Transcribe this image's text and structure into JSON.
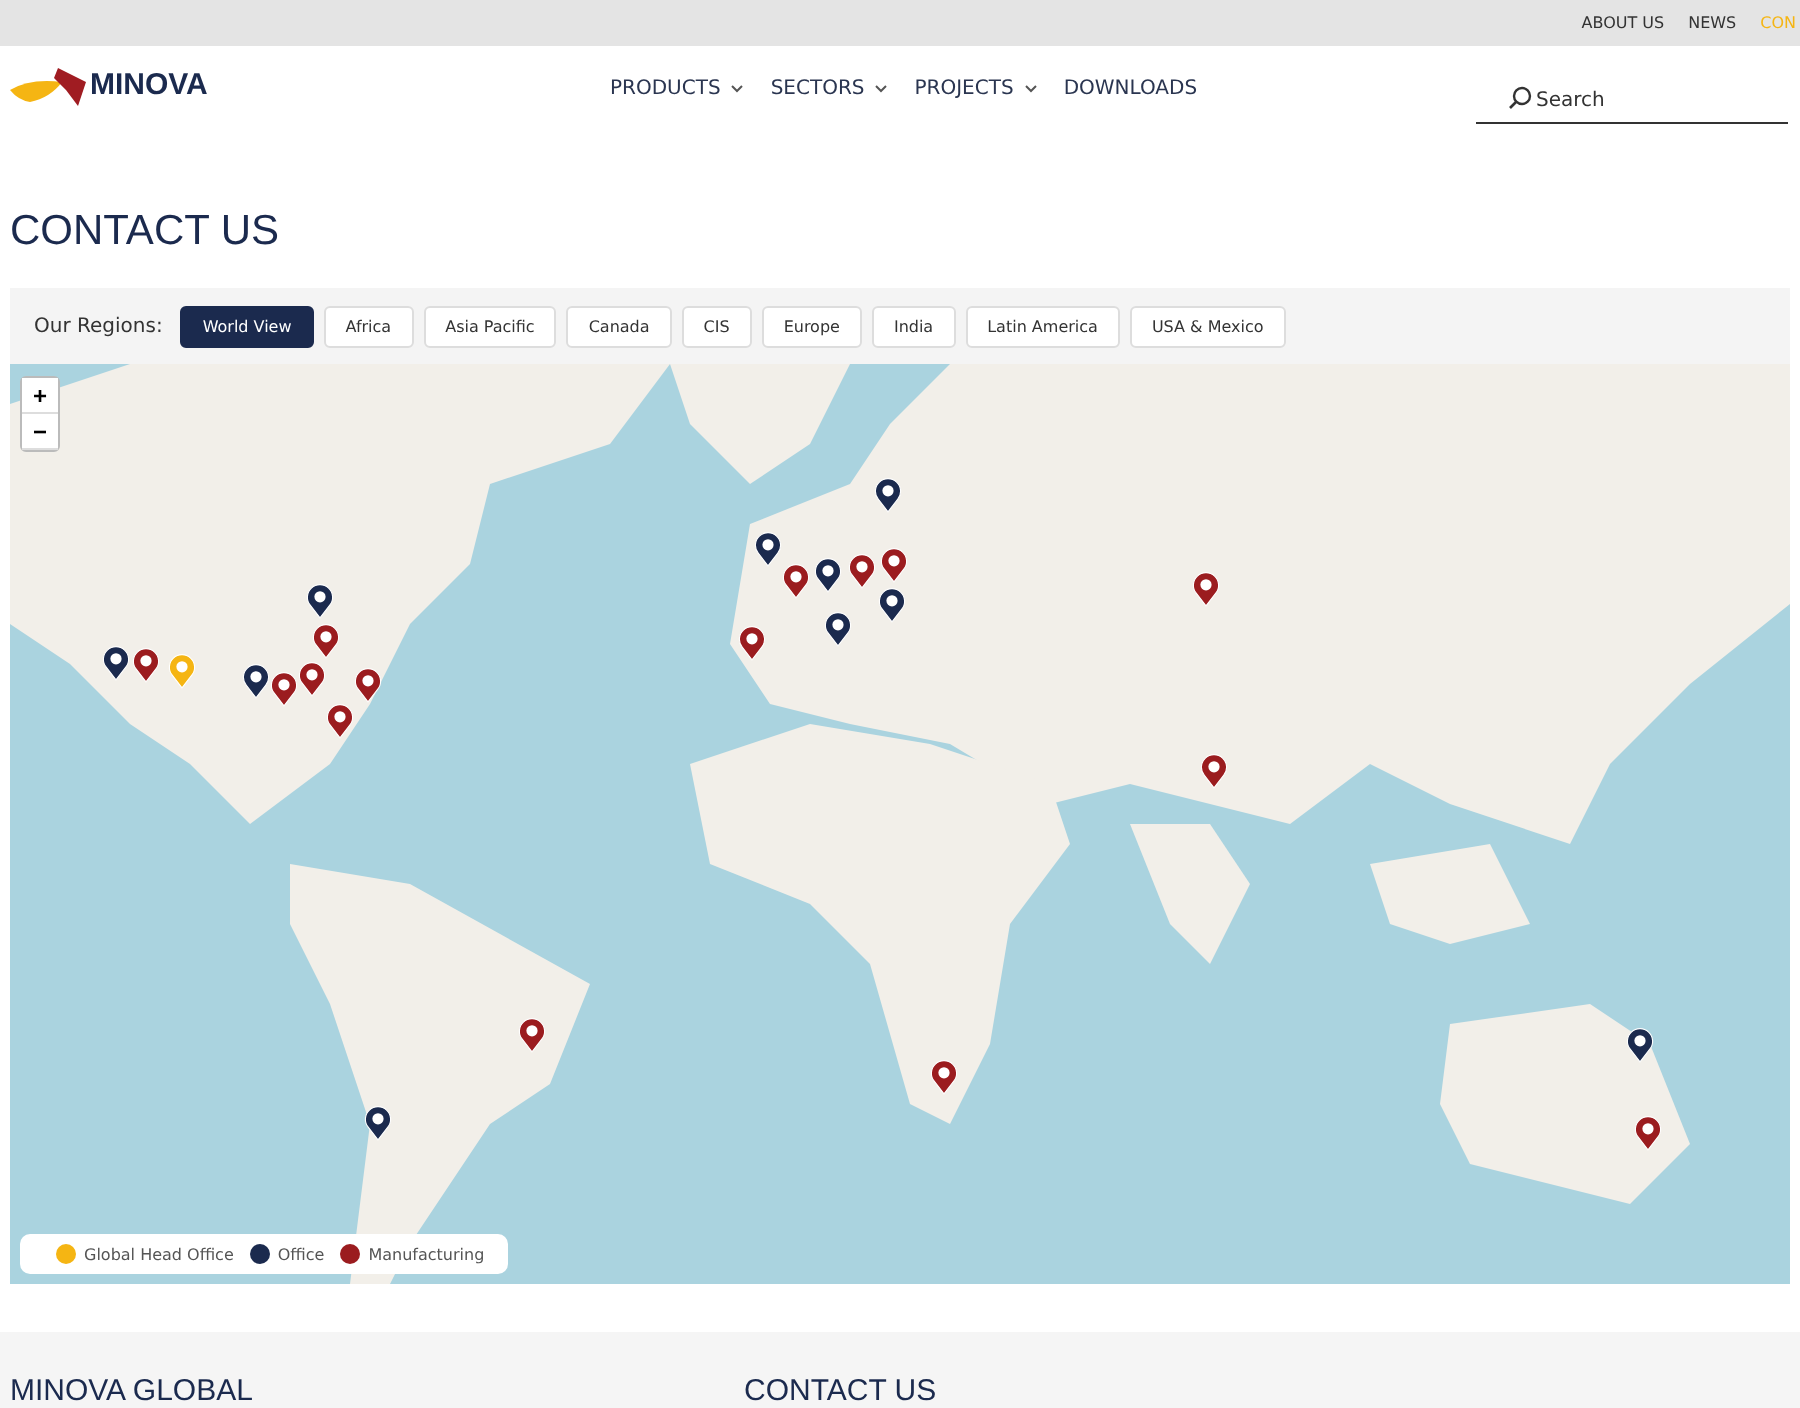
{
  "top_links": [
    {
      "label": "ABOUT US",
      "active": false
    },
    {
      "label": "NEWS",
      "active": false
    },
    {
      "label": "CON",
      "active": true
    }
  ],
  "logo": {
    "text": "MINOVA"
  },
  "nav": [
    {
      "label": "PRODUCTS",
      "has_dropdown": true
    },
    {
      "label": "SECTORS",
      "has_dropdown": true
    },
    {
      "label": "PROJECTS",
      "has_dropdown": true
    },
    {
      "label": "DOWNLOADS",
      "has_dropdown": false
    }
  ],
  "search": {
    "placeholder": "Search"
  },
  "page_title": "CONTACT US",
  "regions": {
    "label": "Our Regions:",
    "items": [
      {
        "label": "World View",
        "selected": true
      },
      {
        "label": "Africa",
        "selected": false
      },
      {
        "label": "Asia Pacific",
        "selected": false
      },
      {
        "label": "Canada",
        "selected": false
      },
      {
        "label": "CIS",
        "selected": false
      },
      {
        "label": "Europe",
        "selected": false
      },
      {
        "label": "India",
        "selected": false
      },
      {
        "label": "Latin America",
        "selected": false
      },
      {
        "label": "USA & Mexico",
        "selected": false
      }
    ]
  },
  "map": {
    "zoom_in": "+",
    "zoom_out": "−",
    "pins": [
      {
        "kind": "office"
      },
      {
        "kind": "office"
      },
      {
        "kind": "office"
      },
      {
        "kind": "office"
      },
      {
        "kind": "office"
      },
      {
        "kind": "office"
      },
      {
        "kind": "office"
      },
      {
        "kind": "office"
      },
      {
        "kind": "office"
      },
      {
        "kind": "office"
      },
      {
        "kind": "manufacturing"
      },
      {
        "kind": "manufacturing"
      },
      {
        "kind": "manufacturing"
      },
      {
        "kind": "manufacturing"
      },
      {
        "kind": "manufacturing"
      },
      {
        "kind": "manufacturing"
      },
      {
        "kind": "manufacturing"
      },
      {
        "kind": "manufacturing"
      },
      {
        "kind": "manufacturing"
      },
      {
        "kind": "manufacturing"
      },
      {
        "kind": "manufacturing"
      },
      {
        "kind": "manufacturing"
      },
      {
        "kind": "manufacturing"
      },
      {
        "kind": "manufacturing"
      },
      {
        "kind": "manufacturing"
      },
      {
        "kind": "head"
      }
    ],
    "legend": [
      {
        "label": "Global Head Office",
        "color": "#f5b513"
      },
      {
        "label": "Office",
        "color": "#1b2a4e"
      },
      {
        "label": "Manufacturing",
        "color": "#9b1c1f"
      }
    ]
  },
  "footer": {
    "columns": [
      "MINOVA GLOBAL",
      "CONTACT US"
    ]
  }
}
